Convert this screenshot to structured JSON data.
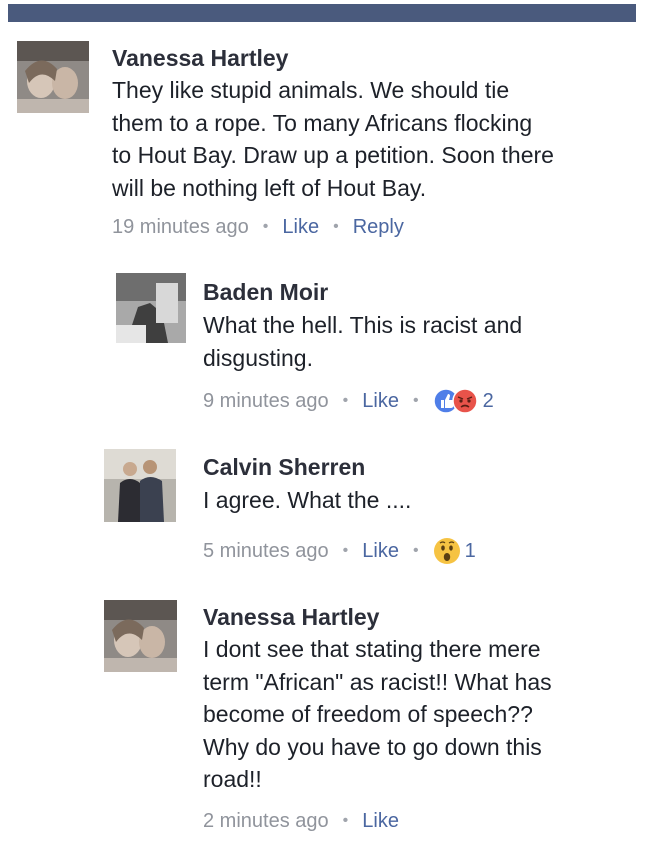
{
  "comments": [
    {
      "name": "Vanessa Hartley",
      "text_lines": [
        "They like stupid animals. We should tie",
        "them to a rope. To many Africans flocking",
        "to Hout Bay. Draw up a petition. Soon there",
        "will be nothing left of Hout Bay."
      ],
      "time": "19 minutes ago",
      "like": "Like",
      "reply": "Reply"
    },
    {
      "name": "Baden Moir",
      "text_lines": [
        "What the hell. This is racist and",
        "disgusting."
      ],
      "time": "9 minutes ago",
      "like": "Like",
      "reaction_count": "2"
    },
    {
      "name": "Calvin Sherren",
      "text_lines": [
        "I agree. What the ...."
      ],
      "time": "5 minutes ago",
      "like": "Like",
      "reaction_count": "1"
    },
    {
      "name": "Vanessa Hartley",
      "text_lines": [
        "I dont see that stating there mere",
        "term \"African\" as racist!! What has",
        "become of freedom of speech??",
        "Why do you have to go down this",
        "road!!"
      ],
      "time": "2 minutes ago",
      "like": "Like"
    }
  ],
  "colors": {
    "link": "#4b67a1",
    "meta": "#90949c",
    "header_bar": "#4a5a7d",
    "like_reaction": "#4f7ee8",
    "angry_reaction": "#e8534a",
    "wow_reaction": "#f6c343"
  },
  "icons": [
    "like-reaction-icon",
    "angry-reaction-icon",
    "wow-reaction-icon"
  ]
}
